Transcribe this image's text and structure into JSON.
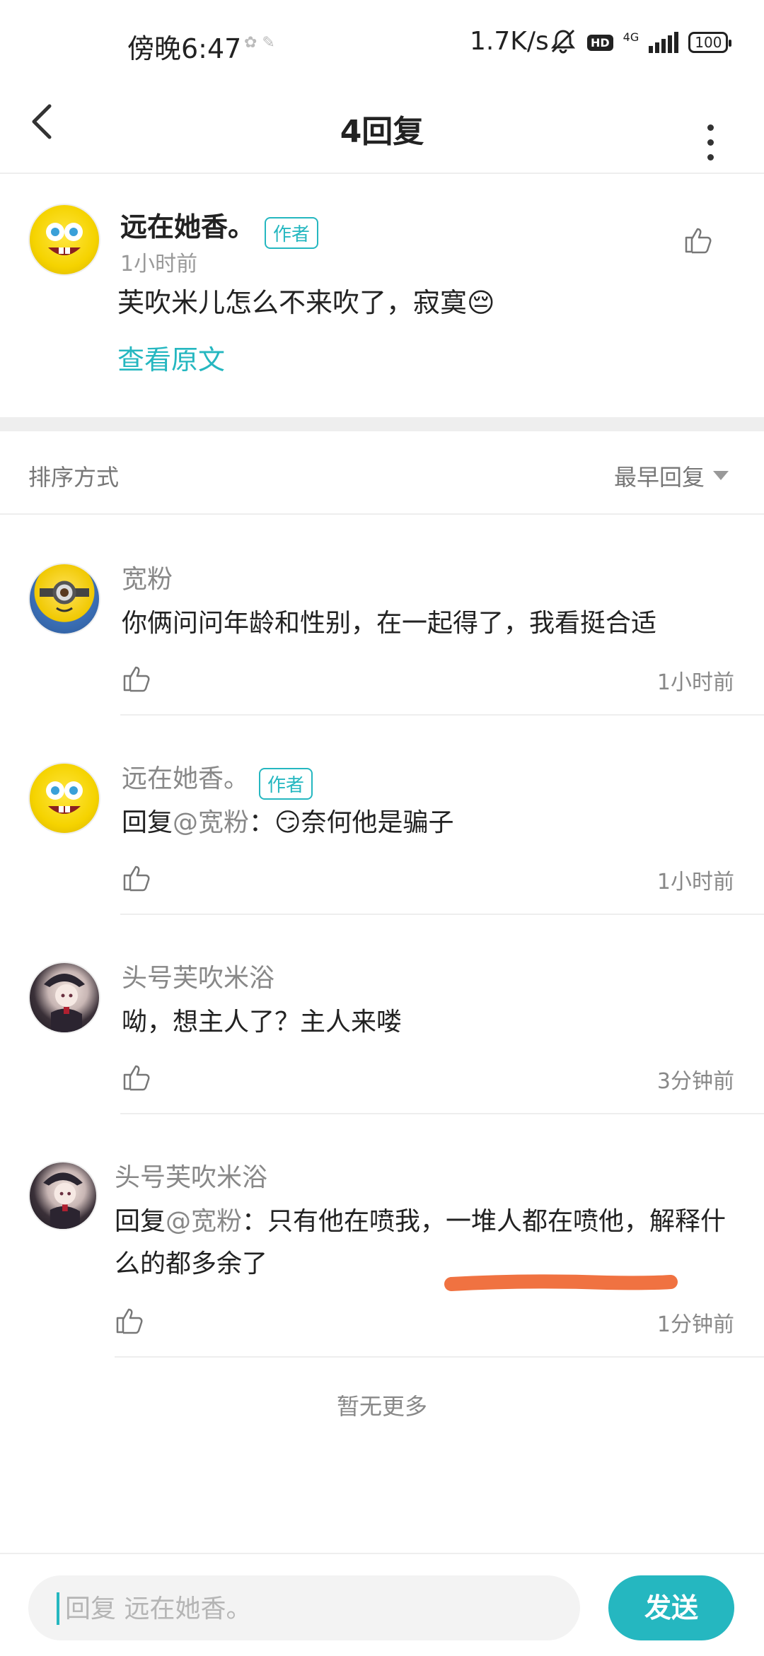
{
  "status_bar": {
    "time": "傍晚6:47",
    "indicators": "✿ ✎",
    "speed": "1.7K/s",
    "network": "4G",
    "battery": "100"
  },
  "header": {
    "title": "4回复"
  },
  "original": {
    "author": "远在她香。",
    "author_tag": "作者",
    "time": "1小时前",
    "text": "芙吹米儿怎么不来吹了，寂寞😔",
    "view_original": "查看原文"
  },
  "sort": {
    "label": "排序方式",
    "value": "最早回复"
  },
  "replies": [
    {
      "name": "宽粉",
      "tag": "",
      "prefix": "",
      "mention": "",
      "text": "你俩问问年龄和性别，在一起得了，我看挺合适",
      "time": "1小时前"
    },
    {
      "name": "远在她香。",
      "tag": "作者",
      "prefix": "回复",
      "mention": "@宽粉",
      "text": "：😏奈何他是骗子",
      "time": "1小时前"
    },
    {
      "name": "头号芙吹米浴",
      "tag": "",
      "prefix": "",
      "mention": "",
      "text": "呦，想主人了？主人来喽",
      "time": "3分钟前"
    },
    {
      "name": "头号芙吹米浴",
      "tag": "",
      "prefix": "回复",
      "mention": "@宽粉",
      "text": "：只有他在喷我，一堆人都在喷他，解释什么的都多余了",
      "time": "1分钟前"
    }
  ],
  "footer_note": "暂无更多",
  "composer": {
    "placeholder": "回复 远在她香。",
    "send_label": "发送"
  },
  "colors": {
    "accent": "#25b7c0",
    "highlight_stroke": "#f07241"
  }
}
